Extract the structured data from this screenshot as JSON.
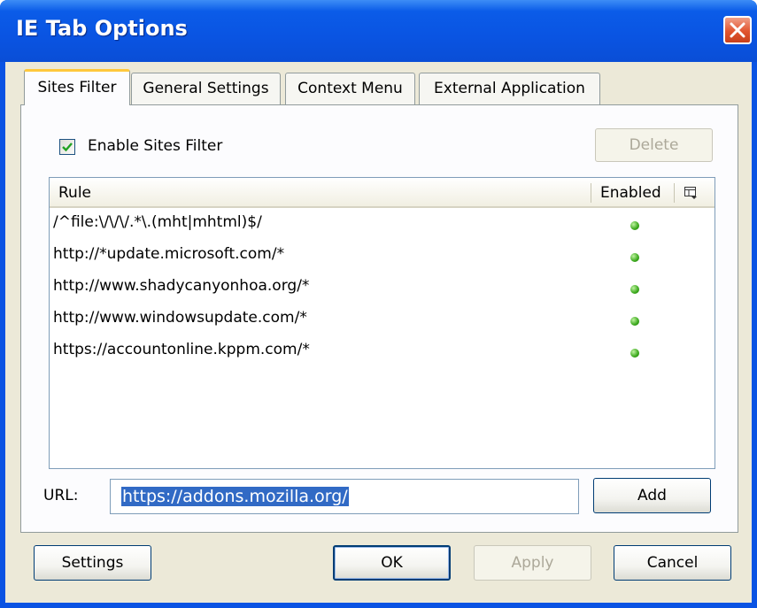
{
  "window": {
    "title": "IE Tab Options"
  },
  "tabs": [
    {
      "label": "Sites Filter",
      "active": true
    },
    {
      "label": "General Settings",
      "active": false
    },
    {
      "label": "Context Menu",
      "active": false
    },
    {
      "label": "External Application",
      "active": false
    }
  ],
  "sites_filter": {
    "enable_label": "Enable Sites Filter",
    "enable_checked": true,
    "delete_label": "Delete",
    "columns": {
      "rule": "Rule",
      "enabled": "Enabled"
    },
    "rules": [
      {
        "rule": "/^file:\\/\\/\\/.*\\.(mht|mhtml)$/",
        "enabled": true
      },
      {
        "rule": "http://*update.microsoft.com/*",
        "enabled": true
      },
      {
        "rule": "http://www.shadycanyonhoa.org/*",
        "enabled": true
      },
      {
        "rule": "http://www.windowsupdate.com/*",
        "enabled": true
      },
      {
        "rule": "https://accountonline.kppm.com/*",
        "enabled": true
      }
    ],
    "url_label": "URL:",
    "url_value": "https://addons.mozilla.org/",
    "add_label": "Add"
  },
  "footer": {
    "settings_label": "Settings",
    "ok_label": "OK",
    "apply_label": "Apply",
    "cancel_label": "Cancel"
  },
  "colors": {
    "titlebar": "#0a54e2",
    "dialog_bg": "#ece9d8",
    "active_tab_accent": "#ffc83c",
    "enabled_dot": "#3aa81c",
    "selection": "#316ac5"
  }
}
